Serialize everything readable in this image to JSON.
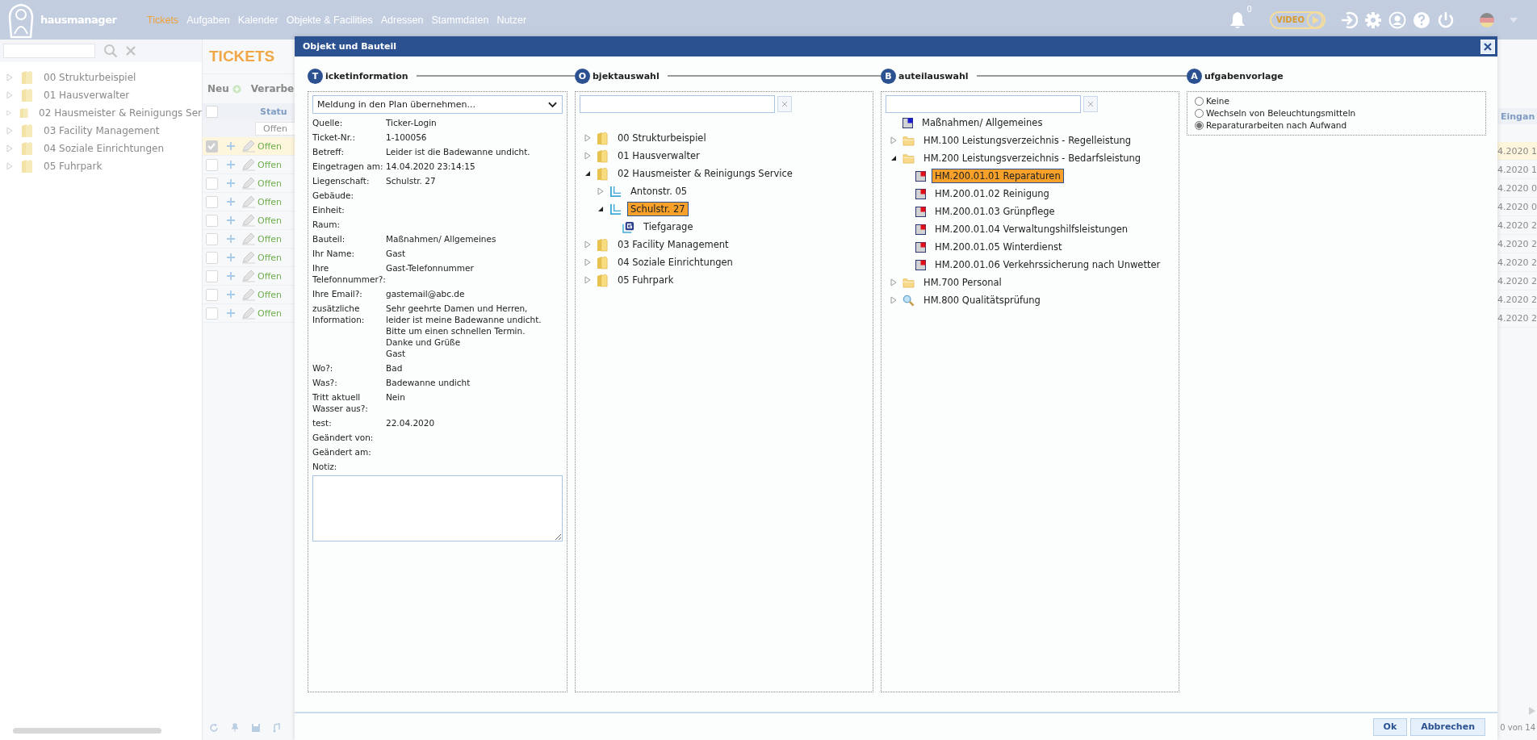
{
  "app": {
    "logo_text": "hausmanager",
    "nav": [
      {
        "label": "Tickets",
        "selected": true
      },
      {
        "label": "Aufgaben",
        "selected": false
      },
      {
        "label": "Kalender",
        "selected": false
      },
      {
        "label": "Objekte & Facilities",
        "selected": false
      },
      {
        "label": "Adressen",
        "selected": false
      },
      {
        "label": "Stammdaten",
        "selected": false
      },
      {
        "label": "Nutzer",
        "selected": false
      }
    ],
    "notification_count": "0",
    "video_label": "VIDEO"
  },
  "sidebar": {
    "tree": [
      {
        "label": "00 Strukturbeispiel",
        "expanded": false
      },
      {
        "label": "01 Hausverwalter",
        "expanded": false
      },
      {
        "label": "02 Hausmeister & Reinigungs Ser",
        "expanded": false
      },
      {
        "label": "03 Facility Management",
        "expanded": false
      },
      {
        "label": "04 Soziale Einrichtungen",
        "expanded": false
      },
      {
        "label": "05 Fuhrpark",
        "expanded": false
      }
    ]
  },
  "tickets": {
    "title": "TICKETS",
    "toolbar": [
      {
        "label": "Neu",
        "kind": "add"
      },
      {
        "label": "Verarbe",
        "kind": "plain"
      }
    ],
    "all_checked": false,
    "status_header": "Statu",
    "status_filter": "Offen",
    "date_header": "Eingan",
    "pager": "0 von 14",
    "rows": [
      {
        "selected": true,
        "checked": true,
        "status": "Offen",
        "date": "4.2020 1"
      },
      {
        "selected": false,
        "checked": false,
        "status": "Offen",
        "date": "4.2020 1"
      },
      {
        "selected": false,
        "checked": false,
        "status": "Offen",
        "date": "4.2020 0"
      },
      {
        "selected": false,
        "checked": false,
        "status": "Offen",
        "date": "4.2020 0"
      },
      {
        "selected": false,
        "checked": false,
        "status": "Offen",
        "date": "4.2020 2"
      },
      {
        "selected": false,
        "checked": false,
        "status": "Offen",
        "date": "4.2020 2"
      },
      {
        "selected": false,
        "checked": false,
        "status": "Offen",
        "date": "4.2020 2"
      },
      {
        "selected": false,
        "checked": false,
        "status": "Offen",
        "date": "4.2020 2"
      },
      {
        "selected": false,
        "checked": false,
        "status": "Offen",
        "date": "4.2020 2"
      },
      {
        "selected": false,
        "checked": false,
        "status": "Offen",
        "date": "4.2020 2"
      }
    ]
  },
  "dialog": {
    "title": "Objekt und Bauteil",
    "steps": [
      {
        "letter": "T",
        "label": "icketinformation"
      },
      {
        "letter": "O",
        "label": "bjektauswahl"
      },
      {
        "letter": "B",
        "label": "auteilauswahl"
      },
      {
        "letter": "A",
        "label": "ufgabenvorlage"
      }
    ],
    "ticket": {
      "plan_select": "Meldung in den Plan übernehmen...",
      "note_label": "Notiz:",
      "fields": [
        {
          "label": "Quelle:",
          "value": "Ticker-Login"
        },
        {
          "label": "Ticket-Nr.:",
          "value": "1-100056"
        },
        {
          "label": "Betreff:",
          "value": "Leider ist die Badewanne undicht."
        },
        {
          "label": "Eingetragen am:",
          "value": "14.04.2020 23:14:15"
        },
        {
          "label": "Liegenschaft:",
          "value": "Schulstr. 27"
        },
        {
          "label": "Gebäude:"
        },
        {
          "label": "Einheit:"
        },
        {
          "label": "Raum:"
        },
        {
          "label": "Bauteil:",
          "value": "Maßnahmen/ Allgemeines"
        },
        {
          "label": "Ihr Name:",
          "value": "Gast"
        },
        {
          "label": "Ihre Telefonnummer?:",
          "value": "Gast-Telefonnummer"
        },
        {
          "label": "Ihre Email?:",
          "value": "gastemail@abc.de"
        },
        {
          "label": "zusätzliche Information:",
          "value": "Sehr geehrte Damen und Herren,\nleider ist meine Badewanne undicht.\nBitte um einen schnellen Termin.\nDanke und Grüße\nGast"
        },
        {
          "label": "Wo?:",
          "value": "Bad"
        },
        {
          "label": "Was?:",
          "value": "Badewanne undicht"
        },
        {
          "label": "Tritt aktuell Wasser aus?:",
          "value": "Nein"
        },
        {
          "label": "test:",
          "value": "22.04.2020"
        },
        {
          "label": "Geändert von:"
        },
        {
          "label": "Geändert am:"
        }
      ]
    },
    "object_tree": [
      {
        "label": "00 Strukturbeispiel",
        "kind": "folder",
        "expanded": false,
        "selected": false
      },
      {
        "label": "01 Hausverwalter",
        "kind": "folder",
        "expanded": false,
        "selected": false
      },
      {
        "label": "02 Hausmeister & Reinigungs Service",
        "kind": "folder",
        "expanded": true,
        "selected": false,
        "children": [
          {
            "label": "Antonstr. 05",
            "kind": "property",
            "expanded": false,
            "selected": false
          },
          {
            "label": "Schulstr. 27",
            "kind": "property",
            "expanded": true,
            "selected": true,
            "children": [
              {
                "label": "Tiefgarage",
                "kind": "unit",
                "selected": false
              }
            ]
          }
        ]
      },
      {
        "label": "03 Facility Management",
        "kind": "folder",
        "expanded": false,
        "selected": false
      },
      {
        "label": "04 Soziale Einrichtungen",
        "kind": "folder",
        "expanded": false,
        "selected": false
      },
      {
        "label": "05 Fuhrpark",
        "kind": "folder",
        "expanded": false,
        "selected": false
      }
    ],
    "part_tree": [
      {
        "label": "Maßnahmen/ Allgemeines",
        "kind": "measure",
        "selected": false
      },
      {
        "label": "HM.100 Leistungsverzeichnis - Regelleistung",
        "kind": "folder",
        "expanded": false,
        "selected": false
      },
      {
        "label": "HM.200 Leistungsverzeichnis - Bedarfsleistung",
        "kind": "folder",
        "expanded": true,
        "selected": false,
        "children": [
          {
            "label": "HM.200.01.01 Reparaturen",
            "kind": "part",
            "selected": true
          },
          {
            "label": "HM.200.01.02 Reinigung",
            "kind": "part",
            "selected": false
          },
          {
            "label": "HM.200.01.03 Grünpflege",
            "kind": "part",
            "selected": false
          },
          {
            "label": "HM.200.01.04 Verwaltungshilfsleistungen",
            "kind": "part",
            "selected": false
          },
          {
            "label": "HM.200.01.05 Winterdienst",
            "kind": "part",
            "selected": false
          },
          {
            "label": "HM.200.01.06 Verkehrssicherung nach Unwetter",
            "kind": "part",
            "selected": false
          }
        ]
      },
      {
        "label": "HM.700 Personal",
        "kind": "folder",
        "expanded": false,
        "selected": false
      },
      {
        "label": "HM.800 Qualitätsprüfung",
        "kind": "inspection",
        "expanded": false,
        "selected": false
      }
    ],
    "templates": [
      {
        "label": "Keine",
        "selected": false
      },
      {
        "label": "Wechseln von Beleuchtungsmitteln",
        "selected": false
      },
      {
        "label": "Reparaturarbeiten nach Aufwand",
        "selected": true
      }
    ],
    "buttons": [
      {
        "label": "Ok"
      },
      {
        "label": "Abbrechen"
      }
    ]
  }
}
